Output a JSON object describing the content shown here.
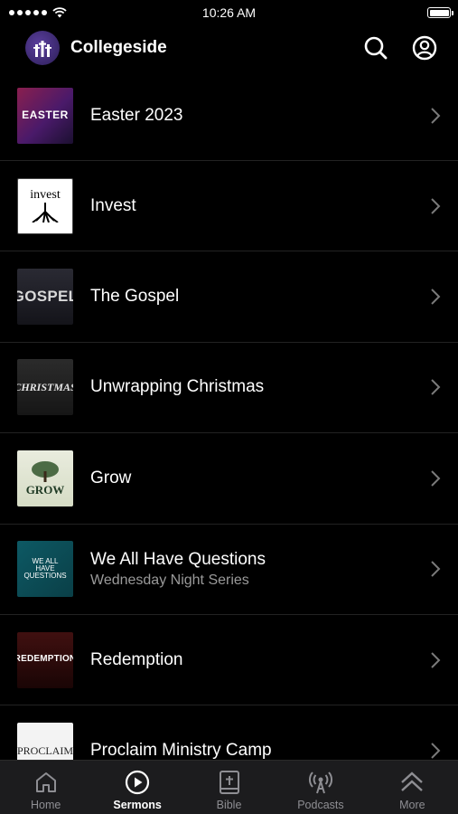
{
  "status_bar": {
    "time": "10:26 AM"
  },
  "header": {
    "title": "Collegeside",
    "icons": [
      "search-icon",
      "account-icon"
    ]
  },
  "series": [
    {
      "title": "Easter 2023",
      "subtitle": "",
      "thumb_text": "EASTER"
    },
    {
      "title": "Invest",
      "subtitle": "",
      "thumb_text": "invest"
    },
    {
      "title": "The Gospel",
      "subtitle": "",
      "thumb_text": "GOSPEL"
    },
    {
      "title": "Unwrapping Christmas",
      "subtitle": "",
      "thumb_text": "CHRISTMAS"
    },
    {
      "title": "Grow",
      "subtitle": "",
      "thumb_text": "GROW"
    },
    {
      "title": "We All Have Questions",
      "subtitle": "Wednesday Night Series",
      "thumb_text": "WE ALL HAVE QUESTIONS"
    },
    {
      "title": "Redemption",
      "subtitle": "",
      "thumb_text": "REDEMPTION"
    },
    {
      "title": "Proclaim Ministry Camp",
      "subtitle": "",
      "thumb_text": "PROCLAIM"
    }
  ],
  "tabs": [
    {
      "label": "Home",
      "icon": "home-icon",
      "active": false
    },
    {
      "label": "Sermons",
      "icon": "play-circle-icon",
      "active": true
    },
    {
      "label": "Bible",
      "icon": "bible-icon",
      "active": false
    },
    {
      "label": "Podcasts",
      "icon": "podcast-icon",
      "active": false
    },
    {
      "label": "More",
      "icon": "chevrons-up-icon",
      "active": false
    }
  ],
  "colors": {
    "background": "#000000",
    "tab_bar": "#1c1c1e",
    "subtitle": "#9a9a9a",
    "tab_inactive": "#8e8e93"
  }
}
